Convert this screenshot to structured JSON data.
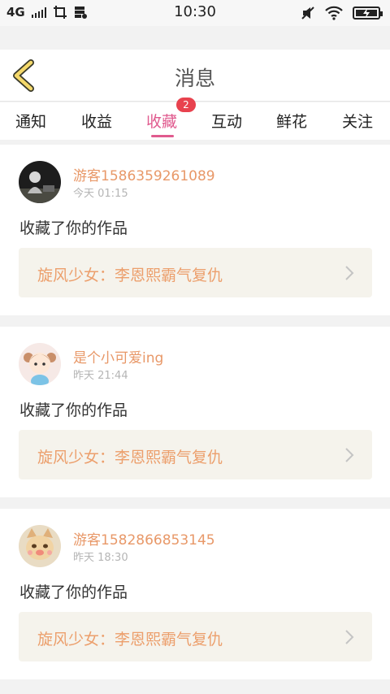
{
  "status_bar": {
    "network": "4G",
    "time": "10:30"
  },
  "header": {
    "title": "消息"
  },
  "tabs": [
    {
      "label": "通知",
      "active": false
    },
    {
      "label": "收益",
      "active": false
    },
    {
      "label": "收藏",
      "active": true,
      "badge": "2"
    },
    {
      "label": "互动",
      "active": false
    },
    {
      "label": "鲜花",
      "active": false
    },
    {
      "label": "关注",
      "active": false
    }
  ],
  "messages": [
    {
      "username": "游客1586359261089",
      "time": "今天 01:15",
      "action": "收藏了你的作品",
      "work_title": "旋风少女：李恩熙霸气复仇",
      "avatar": "dark-figure-avatar"
    },
    {
      "username": "是个小可爱ing",
      "time": "昨天 21:44",
      "action": "收藏了你的作品",
      "work_title": "旋风少女：李恩熙霸气复仇",
      "avatar": "cartoon-girl-avatar"
    },
    {
      "username": "游客1582866853145",
      "time": "昨天 18:30",
      "action": "收藏了你的作品",
      "work_title": "旋风少女：李恩熙霸气复仇",
      "avatar": "cat-avatar"
    }
  ],
  "colors": {
    "accent": "#e05a8e",
    "username": "#e89868",
    "work_title": "#ec9f6c",
    "badge": "#e8424e",
    "back_icon": "#f4d86a"
  }
}
